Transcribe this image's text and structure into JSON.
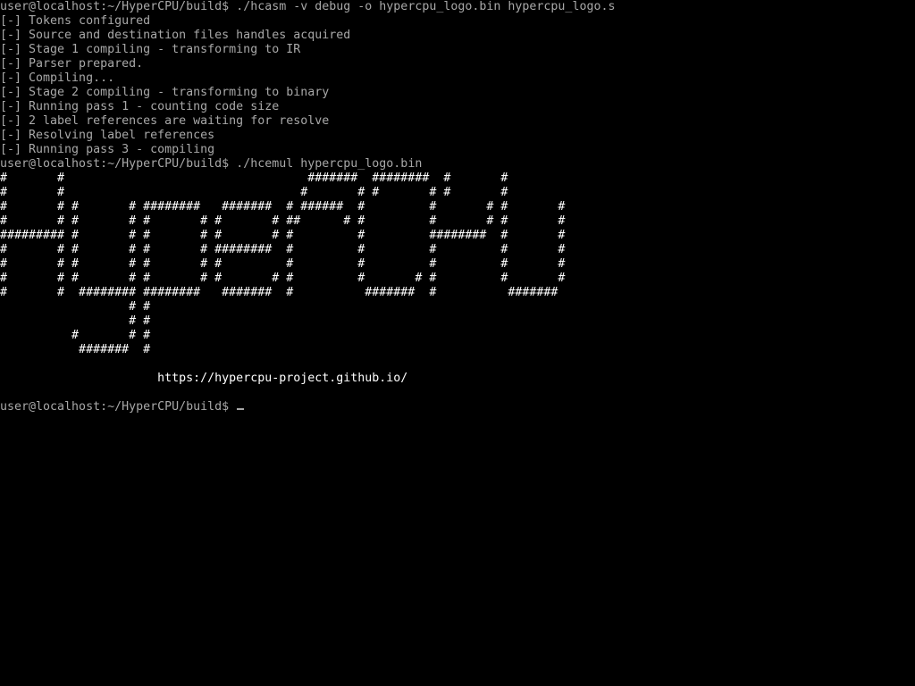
{
  "terminal": {
    "prompt": "user@localhost:~/HyperCPU/build$ ",
    "command1": "./hcasm -v debug -o hypercpu_logo.bin hypercpu_logo.s",
    "log": [
      "[-] Tokens configured",
      "[-] Source and destination files handles acquired",
      "[-] Stage 1 compiling - transforming to IR",
      "[-] Parser prepared.",
      "[-] Compiling...",
      "[-] Stage 2 compiling - transforming to binary",
      "[-] Running pass 1 - counting code size",
      "[-] 2 label references are waiting for resolve",
      "[-] Resolving label references",
      "[-] Running pass 3 - compiling"
    ],
    "command2": "./hcemul hypercpu_logo.bin",
    "ascii_logo": [
      "#       #                                  #######  ########  #       #",
      "#       #                                 #       # #       # #       #",
      "#       # #       # ########   #######  # ######  #         #       # #       #",
      "#       # #       # #       # #       # ##      # #         #       # #       #",
      "######### #       # #       # #       # #         #         ########  #       #",
      "#       # #       # #       # ########  #         #         #         #       #",
      "#       # #       # #       # #         #         #         #         #       #",
      "#       # #       # #       # #       # #         #       # #         #       #",
      "#       #  ######## ########   #######  #          #######  #          #######",
      "                  # #",
      "                  # #",
      "          #       # #",
      "           #######  #"
    ],
    "url": "https://hypercpu-project.github.io/",
    "final_prompt": "user@localhost:~/HyperCPU/build$ "
  }
}
